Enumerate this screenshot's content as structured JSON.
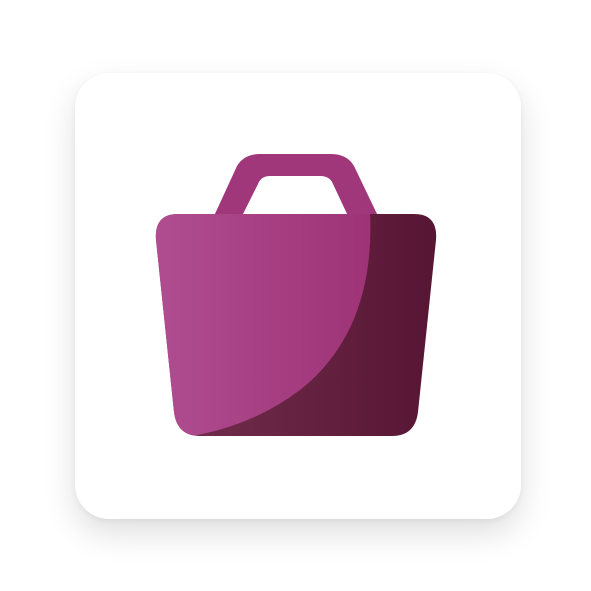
{
  "app_icon": {
    "icon": "shopping-bag-icon",
    "colors": {
      "tile_background": "#ffffff",
      "bag_light_start": "#b04e91",
      "bag_light_end": "#9e3376",
      "bag_dark_start": "#74314f",
      "bag_dark_end": "#561433",
      "handle": "#a0377a"
    }
  }
}
